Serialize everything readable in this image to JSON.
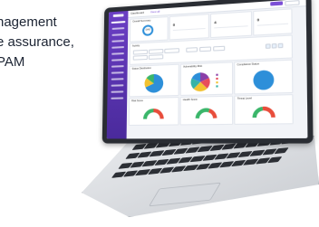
{
  "side_text": {
    "line1": "nagement",
    "line2": "e assurance,",
    "line3": "PAM"
  },
  "laptop": {
    "topbar": {
      "title": "Dashboard",
      "link": "View all"
    },
    "cards": {
      "summary_title": "Overall Summary",
      "summary_value": "0/40",
      "stat1_value": "0",
      "stat2_value": "4",
      "stat3_value": "0",
      "activity_title": "Activity",
      "chart1_title": "Status Distribution",
      "chart2_title": "Vulnerability Risk",
      "chart3_title": "Compliance Status",
      "gauge1_title": "Risk Score",
      "gauge2_title": "Health Score",
      "gauge3_title": "Threat Level"
    }
  },
  "colors": {
    "sidebar": "#5a33b0",
    "accent": "#7b4fd6",
    "pie_blue": "#2d8fd9",
    "pie_red": "#e84d5b",
    "pie_purple": "#8b3fa8",
    "pie_yellow": "#f2c230",
    "pie_teal": "#36b3a7",
    "gauge_green": "#3ab66a",
    "gauge_red": "#e84d3b"
  }
}
